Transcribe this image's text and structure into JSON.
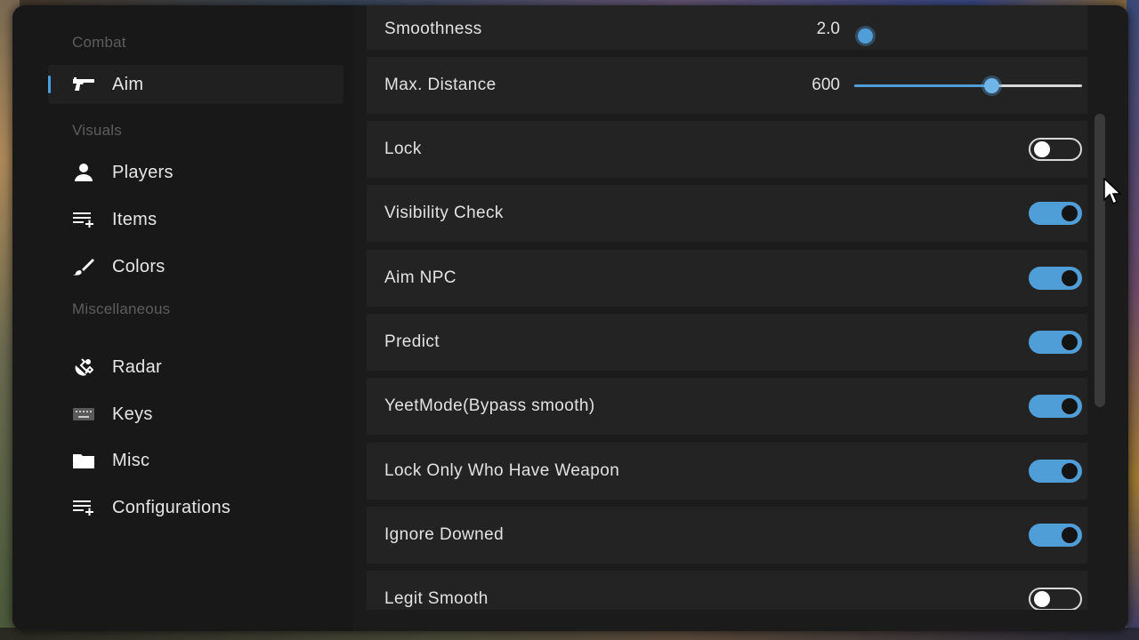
{
  "sidebar": {
    "sections": [
      {
        "label": "Combat"
      },
      {
        "label": "Visuals"
      },
      {
        "label": "Miscellaneous"
      }
    ],
    "items": [
      {
        "label": "Aim",
        "icon": "gun-icon",
        "active": true
      },
      {
        "label": "Players",
        "icon": "person-icon"
      },
      {
        "label": "Items",
        "icon": "list-add-icon"
      },
      {
        "label": "Colors",
        "icon": "brush-icon"
      },
      {
        "label": "Radar",
        "icon": "radar-icon"
      },
      {
        "label": "Keys",
        "icon": "keyboard-icon"
      },
      {
        "label": "Misc",
        "icon": "folder-icon"
      },
      {
        "label": "Configurations",
        "icon": "list-add-icon"
      }
    ]
  },
  "settings": {
    "top_partial": {
      "label": "Smoothness",
      "value": "2.0"
    },
    "max_distance": {
      "label": "Max. Distance",
      "value": "600",
      "fraction": 0.6
    },
    "toggles": [
      {
        "label": "Lock",
        "on": false
      },
      {
        "label": "Visibility Check",
        "on": true
      },
      {
        "label": "Aim NPC",
        "on": true
      },
      {
        "label": "Predict",
        "on": true
      },
      {
        "label": "YeetMode(Bypass smooth)",
        "on": true
      },
      {
        "label": "Lock Only Who Have Weapon",
        "on": true
      },
      {
        "label": "Ignore Downed",
        "on": true
      },
      {
        "label": "Legit Smooth",
        "on": false
      }
    ]
  },
  "colors": {
    "accent": "#4f9ed8",
    "background": "#1b1b1b",
    "row": "#232323"
  }
}
